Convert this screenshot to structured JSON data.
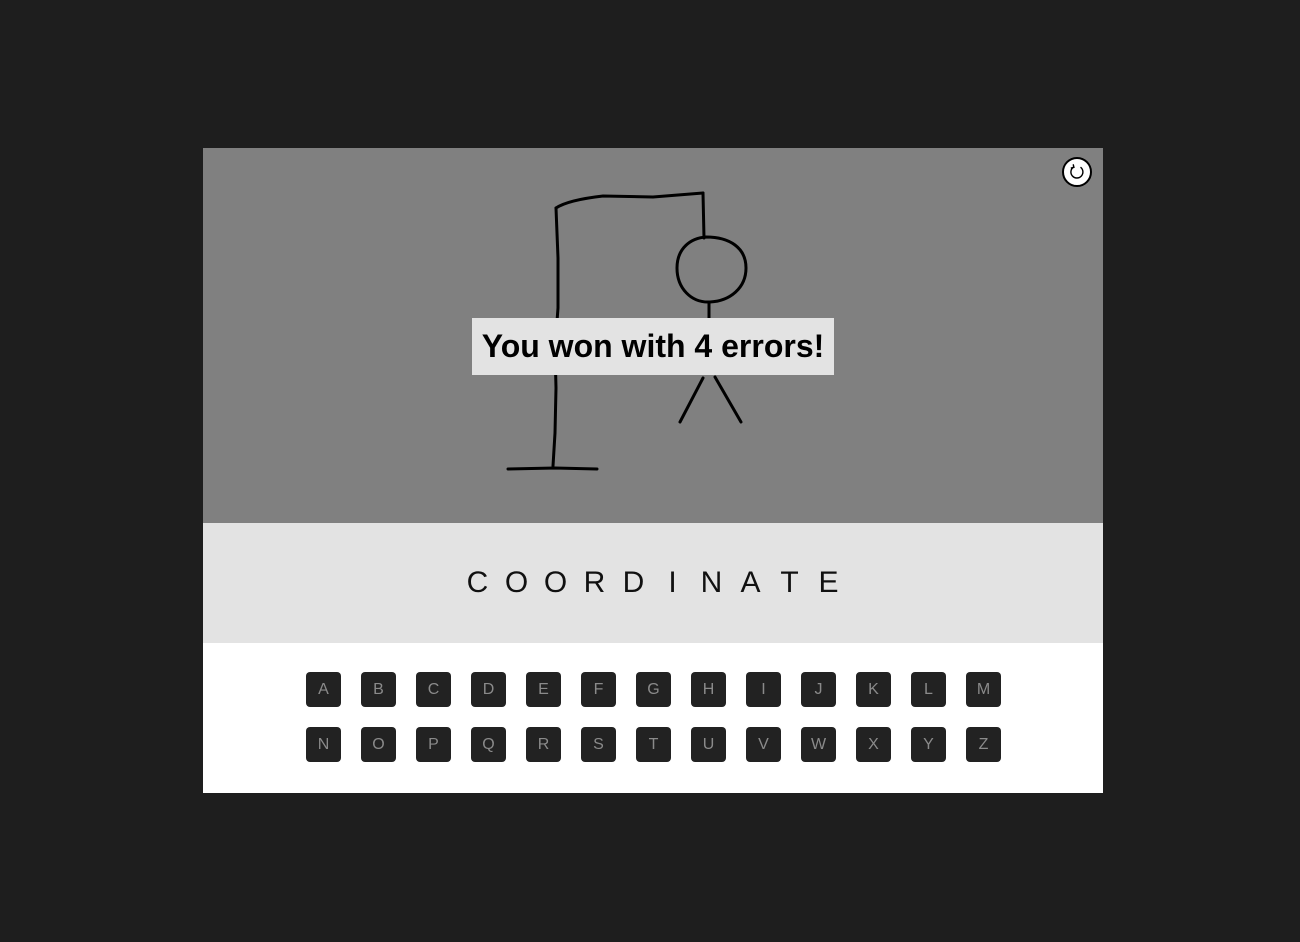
{
  "game": {
    "message": "You won with 4 errors!",
    "errors": 4,
    "word_letters": [
      "C",
      "O",
      "O",
      "R",
      "D",
      "I",
      "N",
      "A",
      "T",
      "E"
    ],
    "restart_icon": "refresh-icon"
  },
  "keyboard": {
    "row1": [
      "A",
      "B",
      "C",
      "D",
      "E",
      "F",
      "G",
      "H",
      "I",
      "J",
      "K",
      "L",
      "M"
    ],
    "row2": [
      "N",
      "O",
      "P",
      "Q",
      "R",
      "S",
      "T",
      "U",
      "V",
      "W",
      "X",
      "Y",
      "Z"
    ]
  },
  "colors": {
    "page_background": "#1e1e1e",
    "stage_background": "#808080",
    "word_panel_background": "#e3e3e3",
    "keyboard_background": "#ffffff",
    "key_background": "#222222",
    "key_text": "#8a8a8a"
  }
}
